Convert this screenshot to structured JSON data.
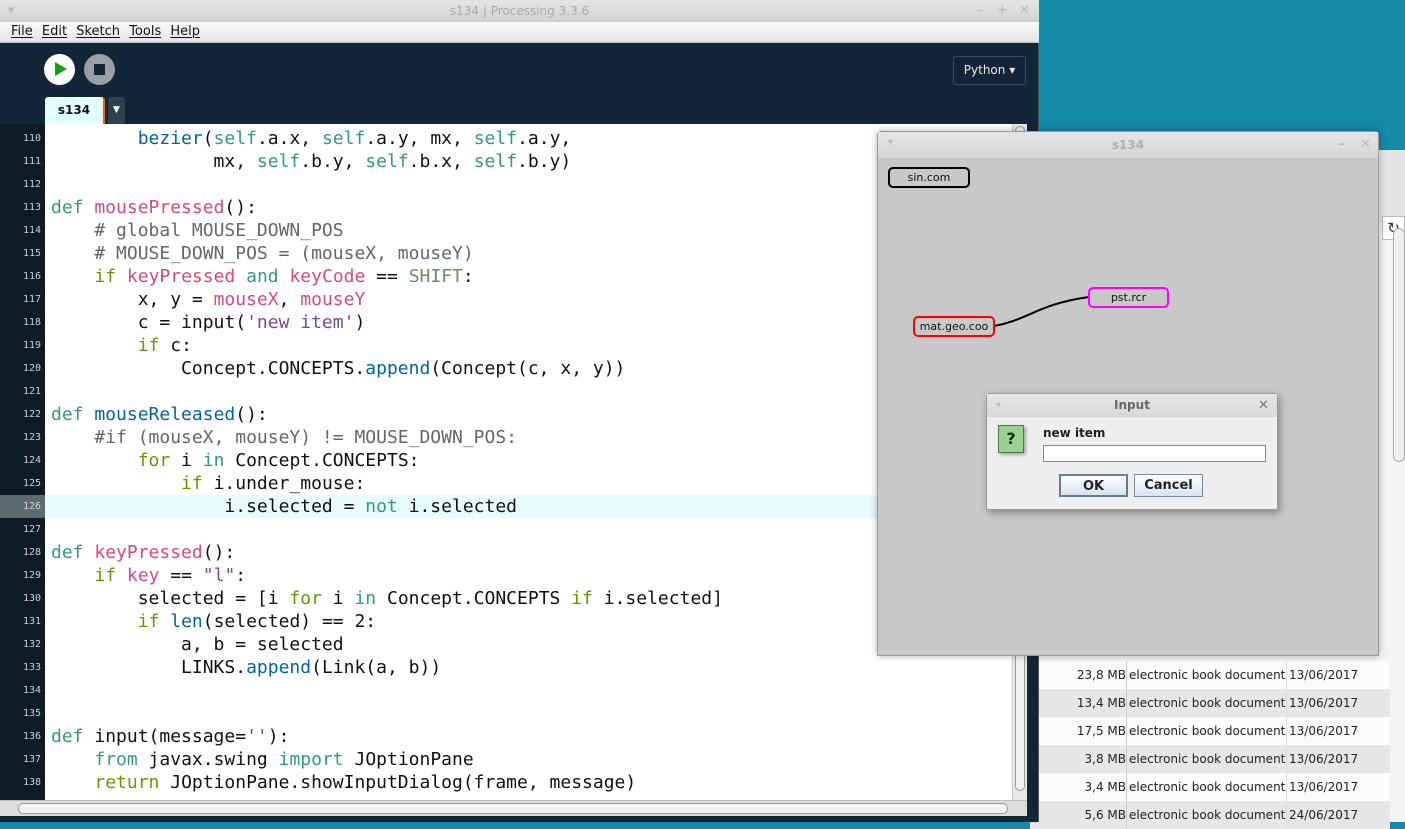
{
  "main_window": {
    "title": "s134 | Processing 3.3.6",
    "window_buttons": [
      "–",
      "+",
      "✕"
    ],
    "menu": [
      "File",
      "Edit",
      "Sketch",
      "Tools",
      "Help"
    ],
    "mode_button": "Python ▾",
    "tab": "s134",
    "tab_dropdown": "▼",
    "highlighted_line": "126",
    "code": [
      {
        "n": "110",
        "t": [
          [
            "        ",
            ""
          ],
          [
            "bezier",
            "bi"
          ],
          [
            "(",
            ""
          ],
          [
            "self",
            "sf"
          ],
          [
            ".a.x, ",
            ""
          ],
          [
            "self",
            "sf"
          ],
          [
            ".a.y, mx, ",
            ""
          ],
          [
            "self",
            "sf"
          ],
          [
            ".a.y,",
            ""
          ]
        ]
      },
      {
        "n": "111",
        "t": [
          [
            "               mx, ",
            ""
          ],
          [
            "self",
            "sf"
          ],
          [
            ".b.y, ",
            ""
          ],
          [
            "self",
            "sf"
          ],
          [
            ".b.x, ",
            ""
          ],
          [
            "self",
            "sf"
          ],
          [
            ".b.y)",
            ""
          ]
        ]
      },
      {
        "n": "112",
        "t": []
      },
      {
        "n": "113",
        "t": [
          [
            "def",
            "kw"
          ],
          [
            " ",
            ""
          ],
          [
            "mousePressed",
            "fn"
          ],
          [
            "():",
            ""
          ]
        ]
      },
      {
        "n": "114",
        "t": [
          [
            "    ",
            ""
          ],
          [
            "# global MOUSE_DOWN_POS",
            "cm"
          ]
        ]
      },
      {
        "n": "115",
        "t": [
          [
            "    ",
            ""
          ],
          [
            "# MOUSE_DOWN_POS = (mouseX, mouseY)",
            "cm"
          ]
        ]
      },
      {
        "n": "116",
        "t": [
          [
            "    ",
            ""
          ],
          [
            "if",
            "ct"
          ],
          [
            " ",
            ""
          ],
          [
            "keyPressed",
            "fn"
          ],
          [
            " ",
            ""
          ],
          [
            "and",
            "kw"
          ],
          [
            " ",
            ""
          ],
          [
            "keyCode",
            "fn"
          ],
          [
            " == ",
            ""
          ],
          [
            "SHIFT",
            "cs"
          ],
          [
            ":",
            ""
          ]
        ]
      },
      {
        "n": "117",
        "t": [
          [
            "        x, y = ",
            ""
          ],
          [
            "mouseX",
            "fn"
          ],
          [
            ", ",
            ""
          ],
          [
            "mouseY",
            "fn"
          ]
        ]
      },
      {
        "n": "118",
        "t": [
          [
            "        c = input(",
            ""
          ],
          [
            "'new item'",
            "st"
          ],
          [
            ")",
            ""
          ]
        ]
      },
      {
        "n": "119",
        "t": [
          [
            "        ",
            ""
          ],
          [
            "if",
            "ct"
          ],
          [
            " c:",
            ""
          ]
        ]
      },
      {
        "n": "120",
        "t": [
          [
            "            Concept.CONCEPTS.",
            ""
          ],
          [
            "append",
            "bi"
          ],
          [
            "(Concept(c, x, y))",
            ""
          ]
        ]
      },
      {
        "n": "121",
        "t": []
      },
      {
        "n": "122",
        "t": [
          [
            "def",
            "kw"
          ],
          [
            " ",
            ""
          ],
          [
            "mouseReleased",
            "bi"
          ],
          [
            "():",
            ""
          ]
        ]
      },
      {
        "n": "123",
        "t": [
          [
            "    ",
            ""
          ],
          [
            "#if (mouseX, mouseY) != MOUSE_DOWN_POS:",
            "cm"
          ]
        ]
      },
      {
        "n": "124",
        "t": [
          [
            "        ",
            ""
          ],
          [
            "for",
            "ct"
          ],
          [
            " i ",
            ""
          ],
          [
            "in",
            "kw"
          ],
          [
            " Concept.CONCEPTS:",
            ""
          ]
        ]
      },
      {
        "n": "125",
        "t": [
          [
            "            ",
            ""
          ],
          [
            "if",
            "ct"
          ],
          [
            " i.under_mouse:",
            ""
          ]
        ]
      },
      {
        "n": "126",
        "t": [
          [
            "                i.selected = ",
            ""
          ],
          [
            "not",
            "kw"
          ],
          [
            " i.selected",
            ""
          ]
        ]
      },
      {
        "n": "127",
        "t": []
      },
      {
        "n": "128",
        "t": [
          [
            "def",
            "kw"
          ],
          [
            " ",
            ""
          ],
          [
            "keyPressed",
            "fn"
          ],
          [
            "():",
            ""
          ]
        ]
      },
      {
        "n": "129",
        "t": [
          [
            "    ",
            ""
          ],
          [
            "if",
            "ct"
          ],
          [
            " ",
            ""
          ],
          [
            "key",
            "fn"
          ],
          [
            " == ",
            ""
          ],
          [
            "\"l\"",
            "st"
          ],
          [
            ":",
            ""
          ]
        ]
      },
      {
        "n": "130",
        "t": [
          [
            "        selected = [i ",
            ""
          ],
          [
            "for",
            "ct"
          ],
          [
            " i ",
            ""
          ],
          [
            "in",
            "kw"
          ],
          [
            " Concept.CONCEPTS ",
            ""
          ],
          [
            "if",
            "ct"
          ],
          [
            " i.selected]",
            ""
          ]
        ]
      },
      {
        "n": "131",
        "t": [
          [
            "        ",
            ""
          ],
          [
            "if",
            "ct"
          ],
          [
            " ",
            ""
          ],
          [
            "len",
            "bi"
          ],
          [
            "(selected) == 2:",
            ""
          ]
        ]
      },
      {
        "n": "132",
        "t": [
          [
            "            a, b = selected",
            ""
          ]
        ]
      },
      {
        "n": "133",
        "t": [
          [
            "            LINKS.",
            ""
          ],
          [
            "append",
            "bi"
          ],
          [
            "(Link(a, b))",
            ""
          ]
        ]
      },
      {
        "n": "134",
        "t": []
      },
      {
        "n": "135",
        "t": []
      },
      {
        "n": "136",
        "t": [
          [
            "def",
            "kw"
          ],
          [
            " input(message=",
            ""
          ],
          [
            "''",
            "st"
          ],
          [
            "):",
            ""
          ]
        ]
      },
      {
        "n": "137",
        "t": [
          [
            "    ",
            ""
          ],
          [
            "from",
            "kw"
          ],
          [
            " javax.swing ",
            ""
          ],
          [
            "import",
            "kw"
          ],
          [
            " JOptionPane",
            ""
          ]
        ]
      },
      {
        "n": "138",
        "t": [
          [
            "    ",
            ""
          ],
          [
            "return",
            "ct"
          ],
          [
            " JOptionPane.showInputDialog(frame, message)",
            ""
          ]
        ]
      }
    ]
  },
  "sketch_window": {
    "title": "s134",
    "window_buttons": [
      "–",
      "✕"
    ],
    "nodes": [
      {
        "label": "sin.com",
        "color": "#000000"
      },
      {
        "label": "mat.geo.coo",
        "color": "#ff0000"
      },
      {
        "label": "pst.rcr",
        "color": "#ff00ff"
      }
    ]
  },
  "input_dialog": {
    "title": "Input",
    "close": "✕",
    "icon": "?",
    "message": "new item",
    "value": "",
    "ok_label": "OK",
    "cancel_label": "Cancel"
  },
  "file_manager": {
    "reload_icon": "↻",
    "rows": [
      {
        "size": "23,8 MB",
        "type": "electronic book document",
        "date": "13/06/2017"
      },
      {
        "size": "13,4 MB",
        "type": "electronic book document",
        "date": "13/06/2017"
      },
      {
        "size": "17,5 MB",
        "type": "electronic book document",
        "date": "13/06/2017"
      },
      {
        "size": "3,8 MB",
        "type": "electronic book document",
        "date": "13/06/2017"
      },
      {
        "size": "3,4 MB",
        "type": "electronic book document",
        "date": "13/06/2017"
      },
      {
        "size": "5,6 MB",
        "type": "electronic book document",
        "date": "24/06/2017"
      }
    ]
  }
}
